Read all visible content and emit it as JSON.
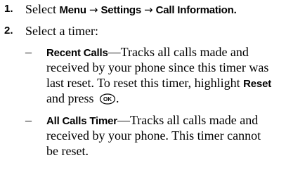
{
  "steps": [
    {
      "number": "1.",
      "prefix": "Select ",
      "path": [
        "Menu",
        "Settings",
        "Call Information."
      ],
      "arrow": "→"
    },
    {
      "number": "2.",
      "text": "Select a timer:"
    }
  ],
  "timers": [
    {
      "dash": "–",
      "name": "Recent Calls",
      "line1_rest": "—Tracks all calls made and",
      "line2": "received by your phone since this timer was",
      "line3_pre": "last reset. To reset this timer, highlight ",
      "line3_bold": "Reset",
      "line4_pre": "and press ",
      "line4_post": ".",
      "key_icon": "ok-key-icon",
      "key_label": "OK"
    },
    {
      "dash": "–",
      "name": "All Calls Timer",
      "line1_rest": "—Tracks all calls made and",
      "line2": "received by your phone. This timer cannot",
      "line3": "be reset."
    }
  ]
}
